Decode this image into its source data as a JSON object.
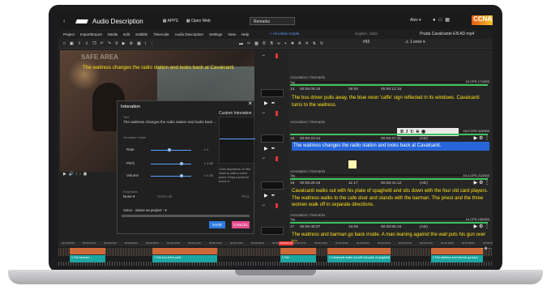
{
  "app": {
    "title": "Audio Description",
    "apps_label": "APPS",
    "open_web_label": "Open Web",
    "mode_select": "Remarks",
    "user": "Alex",
    "brand": "CCNA"
  },
  "menu": {
    "items": [
      "Project",
      "Import/Export",
      "Media",
      "Edit",
      "Subtitle",
      "Timecode",
      "Audio Description",
      "Settings",
      "View",
      "Help"
    ],
    "subtitle_status": "All online scripts",
    "language_info": "English, 24fps",
    "project_name": "Prada Cavalcante EN AD mp4"
  },
  "toolbar": {
    "right_code": "#92",
    "version_select": "1 error"
  },
  "video": {
    "safe_area": "SAFE AREA",
    "caption": "The waitress changes the radio station and looks back at Cavalcanti."
  },
  "dialog": {
    "title": "Intonation",
    "text_label": "Text",
    "text": "The waitress changes the radio station and looks back ...",
    "custom_intonation": "Custom Intonation",
    "intonation_value_label": "Intonation value",
    "sliders": [
      {
        "label": "Rate",
        "value": "x 1",
        "level": 0.45
      },
      {
        "label": "Pitch",
        "value": "x 1.00",
        "level": 0.75
      },
      {
        "label": "Volume",
        "value": "x 1.00",
        "level": 0.75
      }
    ],
    "hint": "Click anywhere on the chart to add a curve point. Drag a point to move it.",
    "emphasis_label": "Emphasis",
    "emphasis_value": "None",
    "select_alt": "Select alt",
    "phrase": "Phra",
    "voice": "Voice - Same as project -",
    "save_label": "SAVE",
    "cancel_label": "CANCEL"
  },
  "list": {
    "rows": [
      {
        "annotation": "Annotation / Remarks",
        "tag": "Tag",
        "cps": "15 CPS  171/500",
        "num": "14",
        "start": "00:06:05:15",
        "dur": "05:00",
        "end": "00:06:12:15",
        "mark": "",
        "text": "The bus driver pulls away, the blue neon 'caffe' sign reflected in its windows. Cavalcanti turns to the waitress.",
        "selected": false
      },
      {
        "annotation": "Annotation / Remarks",
        "tag": "Tag",
        "cps": "16.2 CPS  113/500",
        "num": "15",
        "start": "00:06:23:14",
        "dur": "",
        "end": "00:06:27:11",
        "mark": "(AD)",
        "text": "The waitress changes the radio station and looks back at Cavalcanti.",
        "selected": true
      },
      {
        "annotation": "Annotation / Remarks",
        "tag": "Tag",
        "cps": "15.4 CPS  212/500",
        "num": "16",
        "start": "00:06:29:19",
        "dur": "11:17",
        "end": "00:06:41:12",
        "mark": "(AD)",
        "text": "Cavalcanti walks out with his plate of spaghetti and sits down with the four old card players. The waitress walks to the cafe door and stands with the barman. The priest and the three women walk off in separate directions.",
        "selected": false
      },
      {
        "annotation": "Annotation / Remarks",
        "tag": "Tag",
        "cps": "16 CPS  155/500",
        "num": "17",
        "start": "00:06:45:07",
        "dur": "10:08",
        "end": "00:06:55:15",
        "mark": "(AD)",
        "text": "The waitress and barman go back inside. A man leaning against the wall puts his gun over his",
        "selected": false
      }
    ]
  },
  "timeline": {
    "ticks": [
      "00:06:00:00",
      "00:06:02:00",
      "00:06:04:00",
      "00:06:06:00",
      "00:06:08:00",
      "00:06:10:00",
      "00:06:12:00",
      "00:06:14:00",
      "00:06:16:00",
      "00:06:18:00",
      "00:06:20:00",
      "00:06:22:00",
      "00:06:24:00",
      "00:06:26:00",
      "00:06:28:00",
      "00:06:30:00",
      "00:06:32:00",
      "00:06:34:00",
      "00:06:36:00",
      "00:06:38:00",
      "00:06:40:00"
    ],
    "playhead": "00:06:23:14",
    "clips": [
      "1  The barman...",
      "1  The bus driver pulls",
      "1  The",
      "1  Cavalcanti walks out with his plate of spaghetti",
      "1  The waitress and barman go back"
    ]
  },
  "colors": {
    "caption_yellow": "#ffe21a",
    "selection_blue": "#2766d9",
    "save_blue": "#2f7ce0",
    "cancel_pink": "#e44d8e",
    "clip_teal": "#1aa6a2",
    "clip_orange": "#e8733a"
  }
}
